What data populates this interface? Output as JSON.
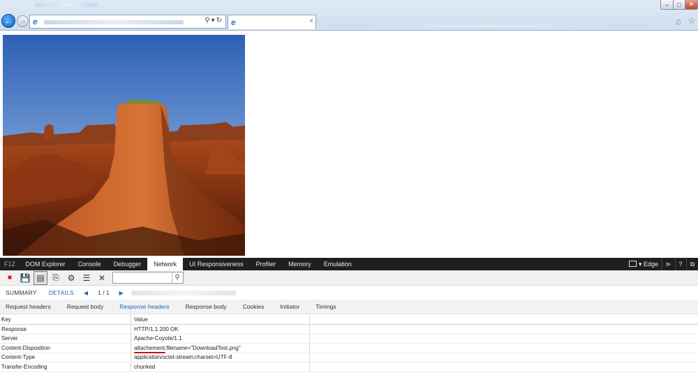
{
  "devtools": {
    "f12_label": "F12",
    "tabs": [
      "DOM Explorer",
      "Console",
      "Debugger",
      "Network",
      "UI Responsiveness",
      "Profiler",
      "Memory",
      "Emulation"
    ],
    "active_tab": "Network",
    "document_mode": "Edge",
    "help_label": "?",
    "network": {
      "summary_label": "SUMMARY",
      "details_label": "DETAILS",
      "pager": "1 / 1",
      "sub_tabs": [
        "Request headers",
        "Request body",
        "Response headers",
        "Response body",
        "Cookies",
        "Initiator",
        "Timings"
      ],
      "active_sub_tab": "Response headers",
      "table": {
        "key_header": "Key",
        "value_header": "Value",
        "rows": [
          {
            "key": "Response",
            "value": "HTTP/1.1 200 OK"
          },
          {
            "key": "Server",
            "value": "Apache-Coyote/1.1"
          },
          {
            "key": "Content-Disposition",
            "value_underlined": "attachement",
            "value_rest": ";filename=\"DownloadTest.png\""
          },
          {
            "key": "Content-Type",
            "value": "application/octet-stream;charset=UTF-8"
          },
          {
            "key": "Transfer-Encoding",
            "value": "chunked"
          }
        ]
      }
    }
  },
  "browser": {
    "tab_close": "×"
  },
  "colors": {
    "accent": "#1a6bb5",
    "annotation_underline": "#c21414"
  }
}
